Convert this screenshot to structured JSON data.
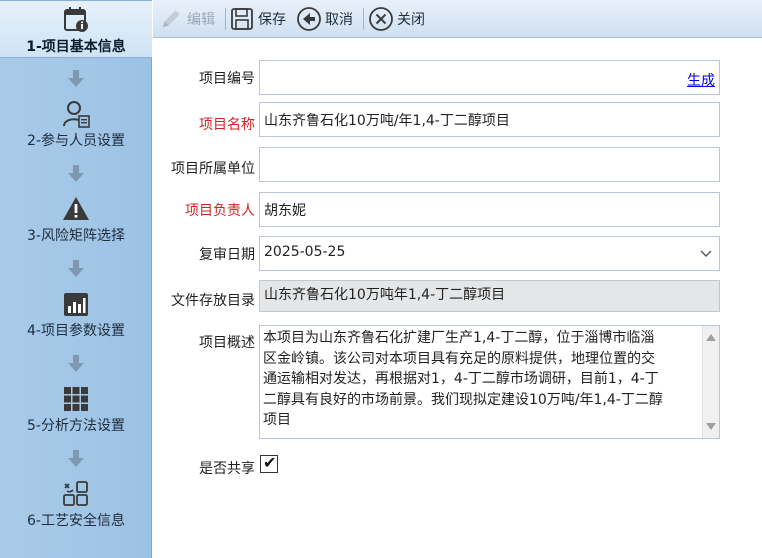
{
  "sidebar": {
    "steps": [
      {
        "label": "1-项目基本信息",
        "icon": "calendar-info-icon",
        "active": true
      },
      {
        "label": "2-参与人员设置",
        "icon": "person-list-icon",
        "active": false
      },
      {
        "label": "3-风险矩阵选择",
        "icon": "warning-icon",
        "active": false
      },
      {
        "label": "4-项目参数设置",
        "icon": "bar-chart-icon",
        "active": false
      },
      {
        "label": "5-分析方法设置",
        "icon": "grid-icon",
        "active": false
      },
      {
        "label": "6-工艺安全信息",
        "icon": "process-blocks-icon",
        "active": false
      }
    ]
  },
  "toolbar": {
    "edit_label": "编辑",
    "save_label": "保存",
    "cancel_label": "取消",
    "close_label": "关闭"
  },
  "form": {
    "project_no": {
      "label": "项目编号",
      "value": "",
      "link": "生成"
    },
    "project_name": {
      "label": "项目名称",
      "value": "山东齐鲁石化10万吨/年1,4-丁二醇项目",
      "required": true
    },
    "project_unit": {
      "label": "项目所属单位",
      "value": ""
    },
    "project_leader": {
      "label": "项目负责人",
      "value": "胡东妮",
      "required": true
    },
    "review_date": {
      "label": "复审日期",
      "value": "2025-05-25"
    },
    "file_dir": {
      "label": "文件存放目录",
      "value": "山东齐鲁石化10万吨年1,4-丁二醇项目"
    },
    "overview": {
      "label": "项目概述",
      "lines": [
        "本项目为山东齐鲁石化扩建厂生产1,4-丁二醇，位于淄博市临淄",
        "区金岭镇。该公司对本项目具有充足的原料提供，地理位置的交",
        "通运输相对发达，再根据对1，4-丁二醇市场调研，目前1，4-丁",
        "二醇具有良好的市场前景。我们现拟定建设10万吨/年1,4-丁二醇",
        "项目"
      ]
    },
    "shared": {
      "label": "是否共享",
      "checked": true,
      "mark": "✔"
    }
  },
  "colors": {
    "required": "#d02424",
    "sidebar": "#a9cbe9",
    "link": "#0000ee"
  }
}
